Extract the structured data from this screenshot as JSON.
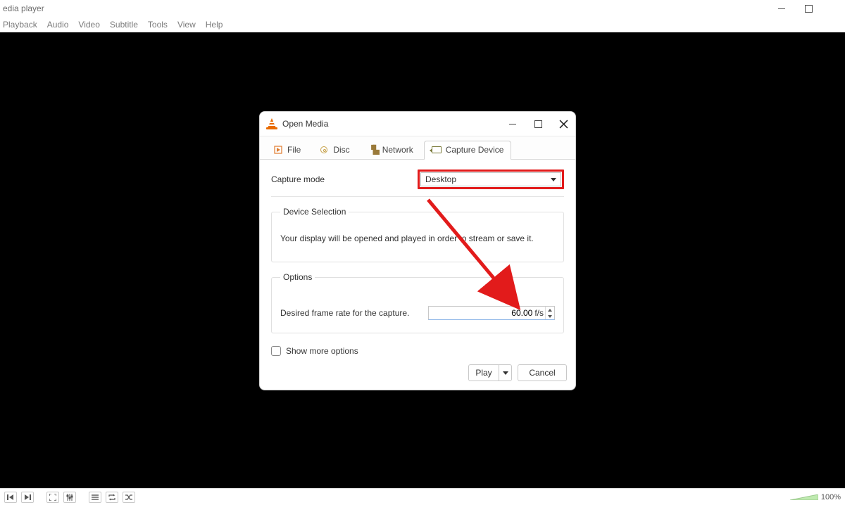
{
  "window": {
    "title": "edia player",
    "zoom": "100%"
  },
  "menubar": [
    "Playback",
    "Audio",
    "Video",
    "Subtitle",
    "Tools",
    "View",
    "Help"
  ],
  "dialog": {
    "title": "Open Media",
    "tabs": {
      "file": "File",
      "disc": "Disc",
      "network": "Network",
      "capture": "Capture Device"
    },
    "capture_mode_label": "Capture mode",
    "capture_mode_value": "Desktop",
    "device_selection": {
      "legend": "Device Selection",
      "text": "Your display will be opened and played in order to stream or save it."
    },
    "options": {
      "legend": "Options",
      "fps_label": "Desired frame rate for the capture.",
      "fps_value": "60.00",
      "fps_unit": "f/s"
    },
    "show_more": "Show more options",
    "play": "Play",
    "cancel": "Cancel"
  }
}
